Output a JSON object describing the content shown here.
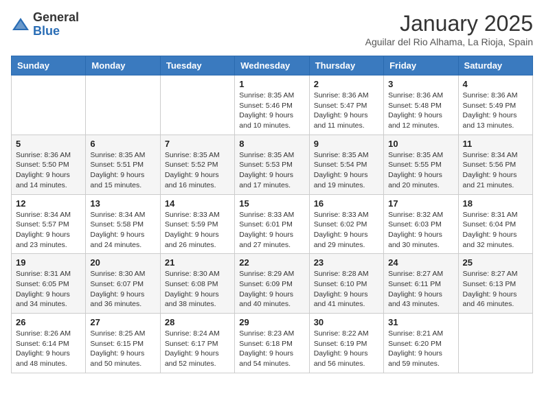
{
  "logo": {
    "general": "General",
    "blue": "Blue"
  },
  "title": "January 2025",
  "subtitle": "Aguilar del Rio Alhama, La Rioja, Spain",
  "days_of_week": [
    "Sunday",
    "Monday",
    "Tuesday",
    "Wednesday",
    "Thursday",
    "Friday",
    "Saturday"
  ],
  "weeks": [
    [
      {
        "day": "",
        "info": ""
      },
      {
        "day": "",
        "info": ""
      },
      {
        "day": "",
        "info": ""
      },
      {
        "day": "1",
        "info": "Sunrise: 8:35 AM\nSunset: 5:46 PM\nDaylight: 9 hours\nand 10 minutes."
      },
      {
        "day": "2",
        "info": "Sunrise: 8:36 AM\nSunset: 5:47 PM\nDaylight: 9 hours\nand 11 minutes."
      },
      {
        "day": "3",
        "info": "Sunrise: 8:36 AM\nSunset: 5:48 PM\nDaylight: 9 hours\nand 12 minutes."
      },
      {
        "day": "4",
        "info": "Sunrise: 8:36 AM\nSunset: 5:49 PM\nDaylight: 9 hours\nand 13 minutes."
      }
    ],
    [
      {
        "day": "5",
        "info": "Sunrise: 8:36 AM\nSunset: 5:50 PM\nDaylight: 9 hours\nand 14 minutes."
      },
      {
        "day": "6",
        "info": "Sunrise: 8:35 AM\nSunset: 5:51 PM\nDaylight: 9 hours\nand 15 minutes."
      },
      {
        "day": "7",
        "info": "Sunrise: 8:35 AM\nSunset: 5:52 PM\nDaylight: 9 hours\nand 16 minutes."
      },
      {
        "day": "8",
        "info": "Sunrise: 8:35 AM\nSunset: 5:53 PM\nDaylight: 9 hours\nand 17 minutes."
      },
      {
        "day": "9",
        "info": "Sunrise: 8:35 AM\nSunset: 5:54 PM\nDaylight: 9 hours\nand 19 minutes."
      },
      {
        "day": "10",
        "info": "Sunrise: 8:35 AM\nSunset: 5:55 PM\nDaylight: 9 hours\nand 20 minutes."
      },
      {
        "day": "11",
        "info": "Sunrise: 8:34 AM\nSunset: 5:56 PM\nDaylight: 9 hours\nand 21 minutes."
      }
    ],
    [
      {
        "day": "12",
        "info": "Sunrise: 8:34 AM\nSunset: 5:57 PM\nDaylight: 9 hours\nand 23 minutes."
      },
      {
        "day": "13",
        "info": "Sunrise: 8:34 AM\nSunset: 5:58 PM\nDaylight: 9 hours\nand 24 minutes."
      },
      {
        "day": "14",
        "info": "Sunrise: 8:33 AM\nSunset: 5:59 PM\nDaylight: 9 hours\nand 26 minutes."
      },
      {
        "day": "15",
        "info": "Sunrise: 8:33 AM\nSunset: 6:01 PM\nDaylight: 9 hours\nand 27 minutes."
      },
      {
        "day": "16",
        "info": "Sunrise: 8:33 AM\nSunset: 6:02 PM\nDaylight: 9 hours\nand 29 minutes."
      },
      {
        "day": "17",
        "info": "Sunrise: 8:32 AM\nSunset: 6:03 PM\nDaylight: 9 hours\nand 30 minutes."
      },
      {
        "day": "18",
        "info": "Sunrise: 8:31 AM\nSunset: 6:04 PM\nDaylight: 9 hours\nand 32 minutes."
      }
    ],
    [
      {
        "day": "19",
        "info": "Sunrise: 8:31 AM\nSunset: 6:05 PM\nDaylight: 9 hours\nand 34 minutes."
      },
      {
        "day": "20",
        "info": "Sunrise: 8:30 AM\nSunset: 6:07 PM\nDaylight: 9 hours\nand 36 minutes."
      },
      {
        "day": "21",
        "info": "Sunrise: 8:30 AM\nSunset: 6:08 PM\nDaylight: 9 hours\nand 38 minutes."
      },
      {
        "day": "22",
        "info": "Sunrise: 8:29 AM\nSunset: 6:09 PM\nDaylight: 9 hours\nand 40 minutes."
      },
      {
        "day": "23",
        "info": "Sunrise: 8:28 AM\nSunset: 6:10 PM\nDaylight: 9 hours\nand 41 minutes."
      },
      {
        "day": "24",
        "info": "Sunrise: 8:27 AM\nSunset: 6:11 PM\nDaylight: 9 hours\nand 43 minutes."
      },
      {
        "day": "25",
        "info": "Sunrise: 8:27 AM\nSunset: 6:13 PM\nDaylight: 9 hours\nand 46 minutes."
      }
    ],
    [
      {
        "day": "26",
        "info": "Sunrise: 8:26 AM\nSunset: 6:14 PM\nDaylight: 9 hours\nand 48 minutes."
      },
      {
        "day": "27",
        "info": "Sunrise: 8:25 AM\nSunset: 6:15 PM\nDaylight: 9 hours\nand 50 minutes."
      },
      {
        "day": "28",
        "info": "Sunrise: 8:24 AM\nSunset: 6:17 PM\nDaylight: 9 hours\nand 52 minutes."
      },
      {
        "day": "29",
        "info": "Sunrise: 8:23 AM\nSunset: 6:18 PM\nDaylight: 9 hours\nand 54 minutes."
      },
      {
        "day": "30",
        "info": "Sunrise: 8:22 AM\nSunset: 6:19 PM\nDaylight: 9 hours\nand 56 minutes."
      },
      {
        "day": "31",
        "info": "Sunrise: 8:21 AM\nSunset: 6:20 PM\nDaylight: 9 hours\nand 59 minutes."
      },
      {
        "day": "",
        "info": ""
      }
    ]
  ]
}
